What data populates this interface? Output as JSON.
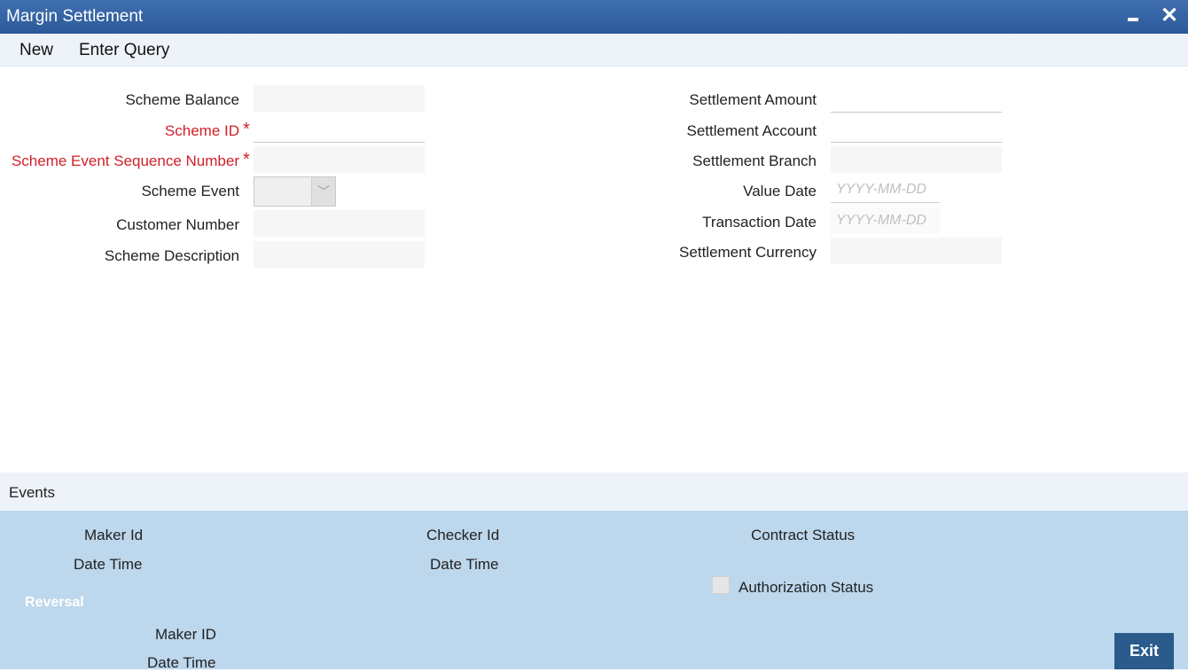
{
  "window": {
    "title": "Margin Settlement"
  },
  "toolbar": {
    "new_label": "New",
    "enter_query_label": "Enter Query"
  },
  "form_left": {
    "scheme_balance": "Scheme Balance",
    "scheme_id": "Scheme ID",
    "scheme_event_seq": "Scheme Event Sequence Number",
    "scheme_event": "Scheme Event",
    "customer_number": "Customer Number",
    "scheme_description": "Scheme Description",
    "required_marker": "*"
  },
  "form_right": {
    "settlement_amount": "Settlement Amount",
    "settlement_account": "Settlement Account",
    "settlement_branch": "Settlement Branch",
    "value_date": "Value Date",
    "value_date_placeholder": "YYYY-MM-DD",
    "transaction_date": "Transaction Date",
    "transaction_date_placeholder": "YYYY-MM-DD",
    "settlement_currency": "Settlement Currency"
  },
  "events": {
    "label": "Events"
  },
  "audit": {
    "maker_id": "Maker Id",
    "date_time": "Date Time",
    "checker_id": "Checker Id",
    "checker_date_time": "Date Time",
    "contract_status": "Contract Status",
    "authorization_status": "Authorization Status",
    "reversal": "Reversal",
    "rev_maker_id": "Maker ID",
    "rev_date_time": "Date Time",
    "exit_label": "Exit"
  },
  "icons": {
    "minimize": "minimize-icon",
    "close": "close-icon",
    "dropdown": "chevron-down-icon"
  },
  "colors": {
    "titlebar": "#2c5a99",
    "required": "#d0202a",
    "audit_panel": "#bdd7ec",
    "exit_button": "#2a5b8c"
  }
}
